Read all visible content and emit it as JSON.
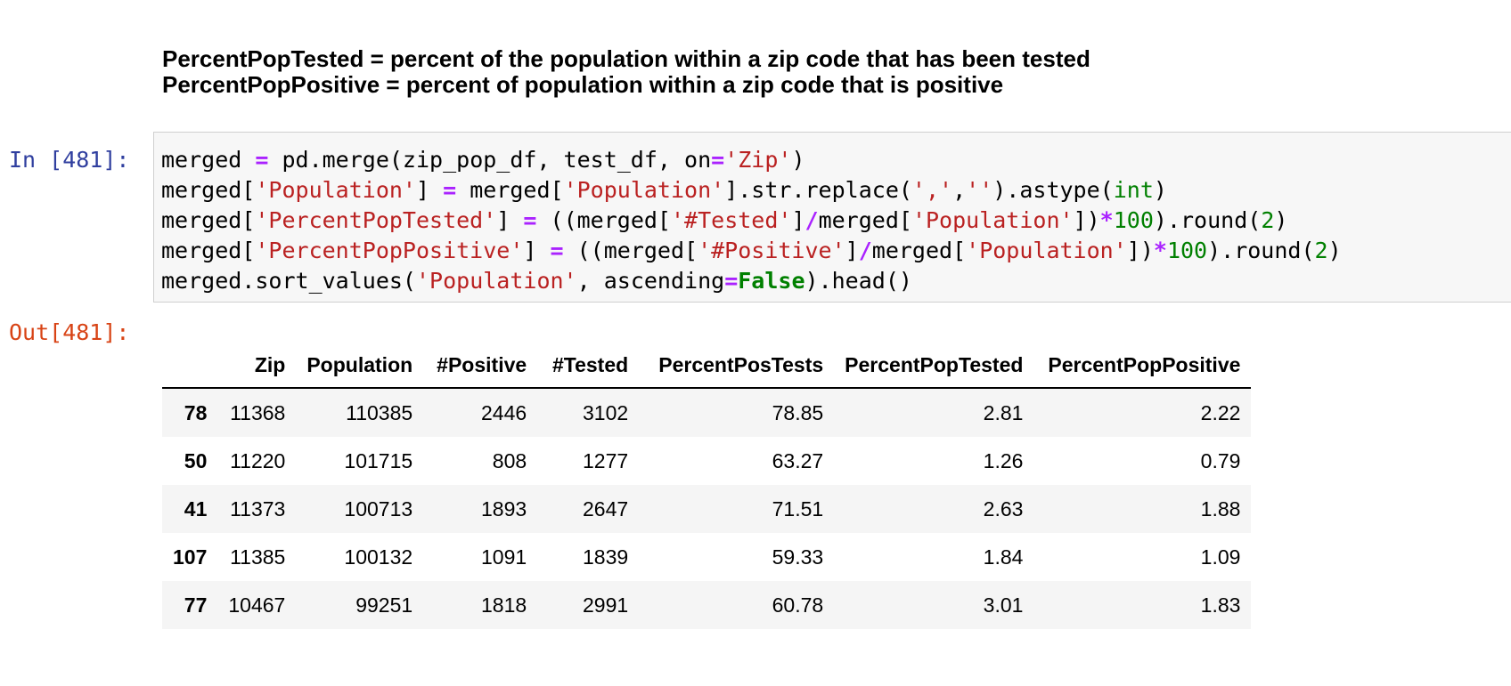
{
  "markdown": {
    "line1": "PercentPopTested = percent of the population within a zip code that has been tested",
    "line2": "PercentPopPositive = percent of population within a zip code that is positive"
  },
  "cell": {
    "in_prompt": "In [481]:",
    "out_prompt": "Out[481]:"
  },
  "code": {
    "l1": [
      "merged ",
      "=",
      " pd.merge(zip_pop_df, test_df, on",
      "=",
      "'Zip'",
      ")"
    ],
    "l2": [
      "merged[",
      "'Population'",
      "] ",
      "=",
      " merged[",
      "'Population'",
      "].str.replace(",
      "','",
      ",",
      "''",
      ").astype(",
      "int",
      ")"
    ],
    "l3": [
      "merged[",
      "'PercentPopTested'",
      "] ",
      "=",
      " ((merged[",
      "'#Tested'",
      "]",
      "/",
      "merged[",
      "'Population'",
      "])",
      "*",
      "100",
      ").round(",
      "2",
      ")"
    ],
    "l4": [
      "merged[",
      "'PercentPopPositive'",
      "] ",
      "=",
      " ((merged[",
      "'#Positive'",
      "]",
      "/",
      "merged[",
      "'Population'",
      "])",
      "*",
      "100",
      ").round(",
      "2",
      ")"
    ],
    "l5": [
      "merged.sort_values(",
      "'Population'",
      ", ascending",
      "=",
      "False",
      ").head()"
    ]
  },
  "table": {
    "columns": [
      "",
      "Zip",
      "Population",
      "#Positive",
      "#Tested",
      "PercentPosTests",
      "PercentPopTested",
      "PercentPopPositive"
    ],
    "rows": [
      [
        "78",
        "11368",
        "110385",
        "2446",
        "3102",
        "78.85",
        "2.81",
        "2.22"
      ],
      [
        "50",
        "11220",
        "101715",
        "808",
        "1277",
        "63.27",
        "1.26",
        "0.79"
      ],
      [
        "41",
        "11373",
        "100713",
        "1893",
        "2647",
        "71.51",
        "2.63",
        "1.88"
      ],
      [
        "107",
        "11385",
        "100132",
        "1091",
        "1839",
        "59.33",
        "1.84",
        "1.09"
      ],
      [
        "77",
        "10467",
        "99251",
        "1818",
        "2991",
        "60.78",
        "3.01",
        "1.83"
      ]
    ]
  }
}
